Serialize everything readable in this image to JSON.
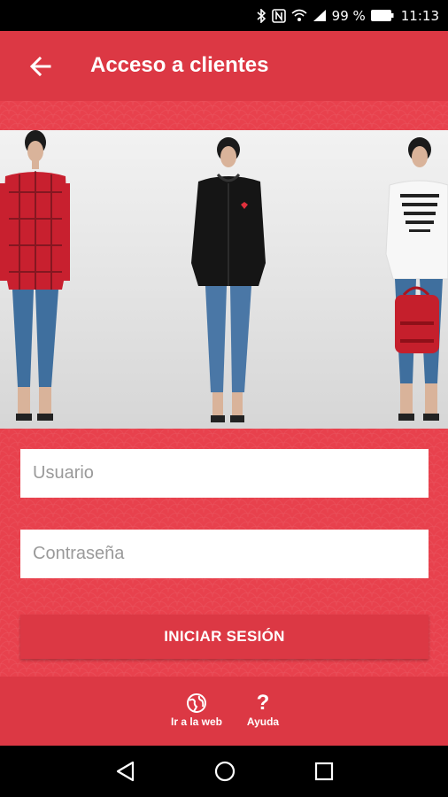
{
  "status_bar": {
    "battery_percent": "99 %",
    "time": "11:13",
    "icons": [
      "bluetooth-icon",
      "nfc-icon",
      "wifi-icon",
      "signal-icon",
      "battery-icon"
    ]
  },
  "app_bar": {
    "title": "Acceso a clientes",
    "back_icon": "arrow-left-icon"
  },
  "login": {
    "username_placeholder": "Usuario",
    "username_value": "",
    "password_placeholder": "Contraseña",
    "password_value": "",
    "submit_label": "INICIAR SESIÓN"
  },
  "footer": {
    "web_label": "Ir a la web",
    "web_icon": "globe-icon",
    "help_label": "Ayuda",
    "help_icon": "question-mark-icon"
  },
  "navigation": {
    "icons": [
      "back-triangle-icon",
      "home-circle-icon",
      "recents-square-icon"
    ]
  },
  "colors": {
    "primary": "#dc3844",
    "background": "#e8414d",
    "on_primary": "#ffffff"
  }
}
